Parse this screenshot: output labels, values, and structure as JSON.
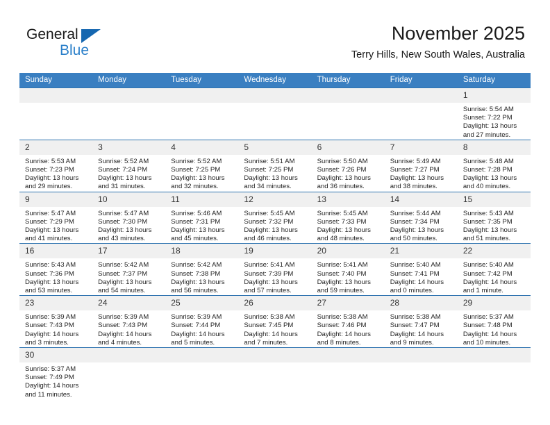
{
  "logo": {
    "word_general": "General",
    "word_blue": "Blue",
    "triangle_color": "#1567b0",
    "blue_color": "#2a7fc9"
  },
  "header": {
    "title": "November 2025",
    "subtitle": "Terry Hills, New South Wales, Australia",
    "header_bg": "#3a7fc1",
    "daynum_bg": "#f0f0f0",
    "row_line_color": "#2e73b0"
  },
  "weekday_headers": [
    "Sunday",
    "Monday",
    "Tuesday",
    "Wednesday",
    "Thursday",
    "Friday",
    "Saturday"
  ],
  "weeks": [
    [
      {
        "day": "",
        "sunrise": "",
        "sunset": "",
        "daylight1": "",
        "daylight2": "",
        "blank": true
      },
      {
        "day": "",
        "sunrise": "",
        "sunset": "",
        "daylight1": "",
        "daylight2": "",
        "blank": true
      },
      {
        "day": "",
        "sunrise": "",
        "sunset": "",
        "daylight1": "",
        "daylight2": "",
        "blank": true
      },
      {
        "day": "",
        "sunrise": "",
        "sunset": "",
        "daylight1": "",
        "daylight2": "",
        "blank": true
      },
      {
        "day": "",
        "sunrise": "",
        "sunset": "",
        "daylight1": "",
        "daylight2": "",
        "blank": true
      },
      {
        "day": "",
        "sunrise": "",
        "sunset": "",
        "daylight1": "",
        "daylight2": "",
        "blank": true
      },
      {
        "day": "1",
        "sunrise": "Sunrise: 5:54 AM",
        "sunset": "Sunset: 7:22 PM",
        "daylight1": "Daylight: 13 hours",
        "daylight2": "and 27 minutes.",
        "blank": false
      }
    ],
    [
      {
        "day": "2",
        "sunrise": "Sunrise: 5:53 AM",
        "sunset": "Sunset: 7:23 PM",
        "daylight1": "Daylight: 13 hours",
        "daylight2": "and 29 minutes.",
        "blank": false
      },
      {
        "day": "3",
        "sunrise": "Sunrise: 5:52 AM",
        "sunset": "Sunset: 7:24 PM",
        "daylight1": "Daylight: 13 hours",
        "daylight2": "and 31 minutes.",
        "blank": false
      },
      {
        "day": "4",
        "sunrise": "Sunrise: 5:52 AM",
        "sunset": "Sunset: 7:25 PM",
        "daylight1": "Daylight: 13 hours",
        "daylight2": "and 32 minutes.",
        "blank": false
      },
      {
        "day": "5",
        "sunrise": "Sunrise: 5:51 AM",
        "sunset": "Sunset: 7:25 PM",
        "daylight1": "Daylight: 13 hours",
        "daylight2": "and 34 minutes.",
        "blank": false
      },
      {
        "day": "6",
        "sunrise": "Sunrise: 5:50 AM",
        "sunset": "Sunset: 7:26 PM",
        "daylight1": "Daylight: 13 hours",
        "daylight2": "and 36 minutes.",
        "blank": false
      },
      {
        "day": "7",
        "sunrise": "Sunrise: 5:49 AM",
        "sunset": "Sunset: 7:27 PM",
        "daylight1": "Daylight: 13 hours",
        "daylight2": "and 38 minutes.",
        "blank": false
      },
      {
        "day": "8",
        "sunrise": "Sunrise: 5:48 AM",
        "sunset": "Sunset: 7:28 PM",
        "daylight1": "Daylight: 13 hours",
        "daylight2": "and 40 minutes.",
        "blank": false
      }
    ],
    [
      {
        "day": "9",
        "sunrise": "Sunrise: 5:47 AM",
        "sunset": "Sunset: 7:29 PM",
        "daylight1": "Daylight: 13 hours",
        "daylight2": "and 41 minutes.",
        "blank": false
      },
      {
        "day": "10",
        "sunrise": "Sunrise: 5:47 AM",
        "sunset": "Sunset: 7:30 PM",
        "daylight1": "Daylight: 13 hours",
        "daylight2": "and 43 minutes.",
        "blank": false
      },
      {
        "day": "11",
        "sunrise": "Sunrise: 5:46 AM",
        "sunset": "Sunset: 7:31 PM",
        "daylight1": "Daylight: 13 hours",
        "daylight2": "and 45 minutes.",
        "blank": false
      },
      {
        "day": "12",
        "sunrise": "Sunrise: 5:45 AM",
        "sunset": "Sunset: 7:32 PM",
        "daylight1": "Daylight: 13 hours",
        "daylight2": "and 46 minutes.",
        "blank": false
      },
      {
        "day": "13",
        "sunrise": "Sunrise: 5:45 AM",
        "sunset": "Sunset: 7:33 PM",
        "daylight1": "Daylight: 13 hours",
        "daylight2": "and 48 minutes.",
        "blank": false
      },
      {
        "day": "14",
        "sunrise": "Sunrise: 5:44 AM",
        "sunset": "Sunset: 7:34 PM",
        "daylight1": "Daylight: 13 hours",
        "daylight2": "and 50 minutes.",
        "blank": false
      },
      {
        "day": "15",
        "sunrise": "Sunrise: 5:43 AM",
        "sunset": "Sunset: 7:35 PM",
        "daylight1": "Daylight: 13 hours",
        "daylight2": "and 51 minutes.",
        "blank": false
      }
    ],
    [
      {
        "day": "16",
        "sunrise": "Sunrise: 5:43 AM",
        "sunset": "Sunset: 7:36 PM",
        "daylight1": "Daylight: 13 hours",
        "daylight2": "and 53 minutes.",
        "blank": false
      },
      {
        "day": "17",
        "sunrise": "Sunrise: 5:42 AM",
        "sunset": "Sunset: 7:37 PM",
        "daylight1": "Daylight: 13 hours",
        "daylight2": "and 54 minutes.",
        "blank": false
      },
      {
        "day": "18",
        "sunrise": "Sunrise: 5:42 AM",
        "sunset": "Sunset: 7:38 PM",
        "daylight1": "Daylight: 13 hours",
        "daylight2": "and 56 minutes.",
        "blank": false
      },
      {
        "day": "19",
        "sunrise": "Sunrise: 5:41 AM",
        "sunset": "Sunset: 7:39 PM",
        "daylight1": "Daylight: 13 hours",
        "daylight2": "and 57 minutes.",
        "blank": false
      },
      {
        "day": "20",
        "sunrise": "Sunrise: 5:41 AM",
        "sunset": "Sunset: 7:40 PM",
        "daylight1": "Daylight: 13 hours",
        "daylight2": "and 59 minutes.",
        "blank": false
      },
      {
        "day": "21",
        "sunrise": "Sunrise: 5:40 AM",
        "sunset": "Sunset: 7:41 PM",
        "daylight1": "Daylight: 14 hours",
        "daylight2": "and 0 minutes.",
        "blank": false
      },
      {
        "day": "22",
        "sunrise": "Sunrise: 5:40 AM",
        "sunset": "Sunset: 7:42 PM",
        "daylight1": "Daylight: 14 hours",
        "daylight2": "and 1 minute.",
        "blank": false
      }
    ],
    [
      {
        "day": "23",
        "sunrise": "Sunrise: 5:39 AM",
        "sunset": "Sunset: 7:43 PM",
        "daylight1": "Daylight: 14 hours",
        "daylight2": "and 3 minutes.",
        "blank": false
      },
      {
        "day": "24",
        "sunrise": "Sunrise: 5:39 AM",
        "sunset": "Sunset: 7:43 PM",
        "daylight1": "Daylight: 14 hours",
        "daylight2": "and 4 minutes.",
        "blank": false
      },
      {
        "day": "25",
        "sunrise": "Sunrise: 5:39 AM",
        "sunset": "Sunset: 7:44 PM",
        "daylight1": "Daylight: 14 hours",
        "daylight2": "and 5 minutes.",
        "blank": false
      },
      {
        "day": "26",
        "sunrise": "Sunrise: 5:38 AM",
        "sunset": "Sunset: 7:45 PM",
        "daylight1": "Daylight: 14 hours",
        "daylight2": "and 7 minutes.",
        "blank": false
      },
      {
        "day": "27",
        "sunrise": "Sunrise: 5:38 AM",
        "sunset": "Sunset: 7:46 PM",
        "daylight1": "Daylight: 14 hours",
        "daylight2": "and 8 minutes.",
        "blank": false
      },
      {
        "day": "28",
        "sunrise": "Sunrise: 5:38 AM",
        "sunset": "Sunset: 7:47 PM",
        "daylight1": "Daylight: 14 hours",
        "daylight2": "and 9 minutes.",
        "blank": false
      },
      {
        "day": "29",
        "sunrise": "Sunrise: 5:37 AM",
        "sunset": "Sunset: 7:48 PM",
        "daylight1": "Daylight: 14 hours",
        "daylight2": "and 10 minutes.",
        "blank": false
      }
    ],
    [
      {
        "day": "30",
        "sunrise": "Sunrise: 5:37 AM",
        "sunset": "Sunset: 7:49 PM",
        "daylight1": "Daylight: 14 hours",
        "daylight2": "and 11 minutes.",
        "blank": false
      },
      {
        "day": "",
        "sunrise": "",
        "sunset": "",
        "daylight1": "",
        "daylight2": "",
        "blank": true
      },
      {
        "day": "",
        "sunrise": "",
        "sunset": "",
        "daylight1": "",
        "daylight2": "",
        "blank": true
      },
      {
        "day": "",
        "sunrise": "",
        "sunset": "",
        "daylight1": "",
        "daylight2": "",
        "blank": true
      },
      {
        "day": "",
        "sunrise": "",
        "sunset": "",
        "daylight1": "",
        "daylight2": "",
        "blank": true
      },
      {
        "day": "",
        "sunrise": "",
        "sunset": "",
        "daylight1": "",
        "daylight2": "",
        "blank": true
      },
      {
        "day": "",
        "sunrise": "",
        "sunset": "",
        "daylight1": "",
        "daylight2": "",
        "blank": true
      }
    ]
  ]
}
